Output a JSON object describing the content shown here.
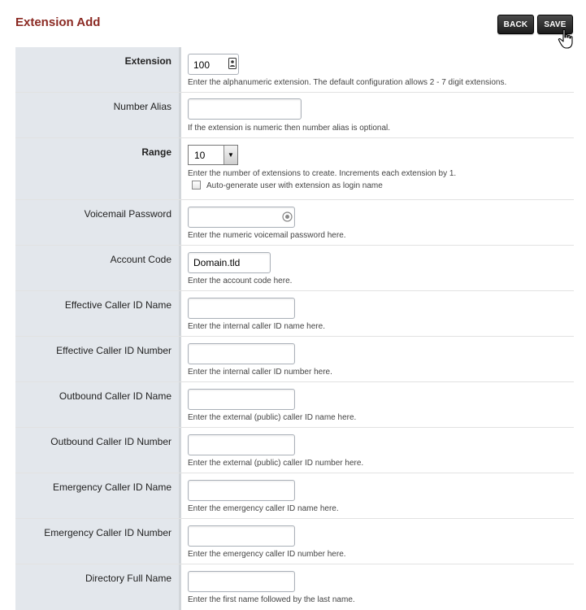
{
  "page": {
    "title": "Extension Add"
  },
  "toolbar": {
    "back_label": "BACK",
    "save_label": "SAVE"
  },
  "rows": {
    "extension": {
      "label": "Extension",
      "value": "100",
      "help": "Enter the alphanumeric extension. The default configuration allows 2 - 7 digit extensions."
    },
    "number_alias": {
      "label": "Number Alias",
      "value": "",
      "help": "If the extension is numeric then number alias is optional."
    },
    "range": {
      "label": "Range",
      "selected": "10",
      "help": "Enter the number of extensions to create. Increments each extension by 1.",
      "checkbox_label": "Auto-generate user with extension as login name",
      "checkbox_checked": false
    },
    "voicemail_password": {
      "label": "Voicemail Password",
      "value": "",
      "help": "Enter the numeric voicemail password here."
    },
    "account_code": {
      "label": "Account Code",
      "value": "Domain.tld",
      "help": "Enter the account code here."
    },
    "effective_cid_name": {
      "label": "Effective Caller ID Name",
      "value": "",
      "help": "Enter the internal caller ID name here."
    },
    "effective_cid_number": {
      "label": "Effective Caller ID Number",
      "value": "",
      "help": "Enter the internal caller ID number here."
    },
    "outbound_cid_name": {
      "label": "Outbound Caller ID Name",
      "value": "",
      "help": "Enter the external (public) caller ID name here."
    },
    "outbound_cid_number": {
      "label": "Outbound Caller ID Number",
      "value": "",
      "help": "Enter the external (public) caller ID number here."
    },
    "emergency_cid_name": {
      "label": "Emergency Caller ID Name",
      "value": "",
      "help": "Enter the emergency caller ID name here."
    },
    "emergency_cid_number": {
      "label": "Emergency Caller ID Number",
      "value": "",
      "help": "Enter the emergency caller ID number here."
    },
    "directory_full_name": {
      "label": "Directory Full Name",
      "value": "",
      "help": "Enter the first name followed by the last name."
    }
  },
  "colors": {
    "title": "#8b2a23",
    "label_bg": "#e3e7ec",
    "button_bg": "#2a2a2a"
  },
  "icons": {
    "extension": "contact-card-icon",
    "password": "password-reveal-icon",
    "select": "chevron-down-icon",
    "cursor": "hand-pointer-icon"
  }
}
